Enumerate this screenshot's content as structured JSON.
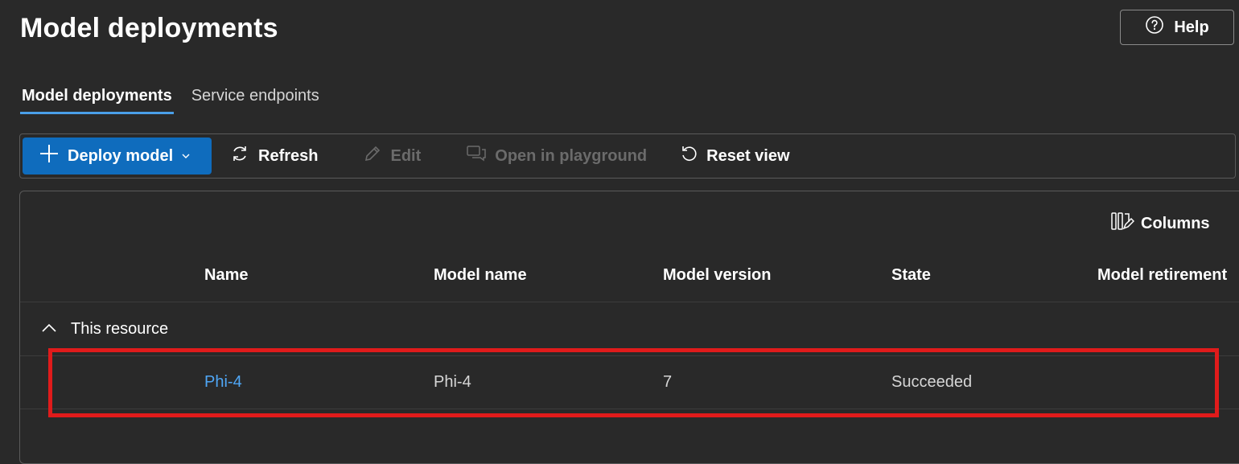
{
  "page": {
    "title": "Model deployments"
  },
  "header": {
    "help_label": "Help",
    "help_icon": "question-circle-icon"
  },
  "tabs": [
    {
      "label": "Model deployments",
      "active": true
    },
    {
      "label": "Service endpoints",
      "active": false
    }
  ],
  "toolbar": {
    "deploy_label": "Deploy model",
    "refresh_label": "Refresh",
    "edit_label": "Edit",
    "playground_label": "Open in playground",
    "reset_label": "Reset view"
  },
  "table": {
    "columns_button": "Columns",
    "headers": [
      "Name",
      "Model name",
      "Model version",
      "State",
      "Model retirement"
    ],
    "group_label": "This resource",
    "rows": [
      {
        "name": "Phi-4",
        "model_name": "Phi-4",
        "model_version": "7",
        "state": "Succeeded",
        "retirement": ""
      }
    ]
  },
  "colors": {
    "background": "#292929",
    "accent": "#0f6cbd",
    "link": "#4fa6f5",
    "highlight_box": "#e01b1b"
  }
}
